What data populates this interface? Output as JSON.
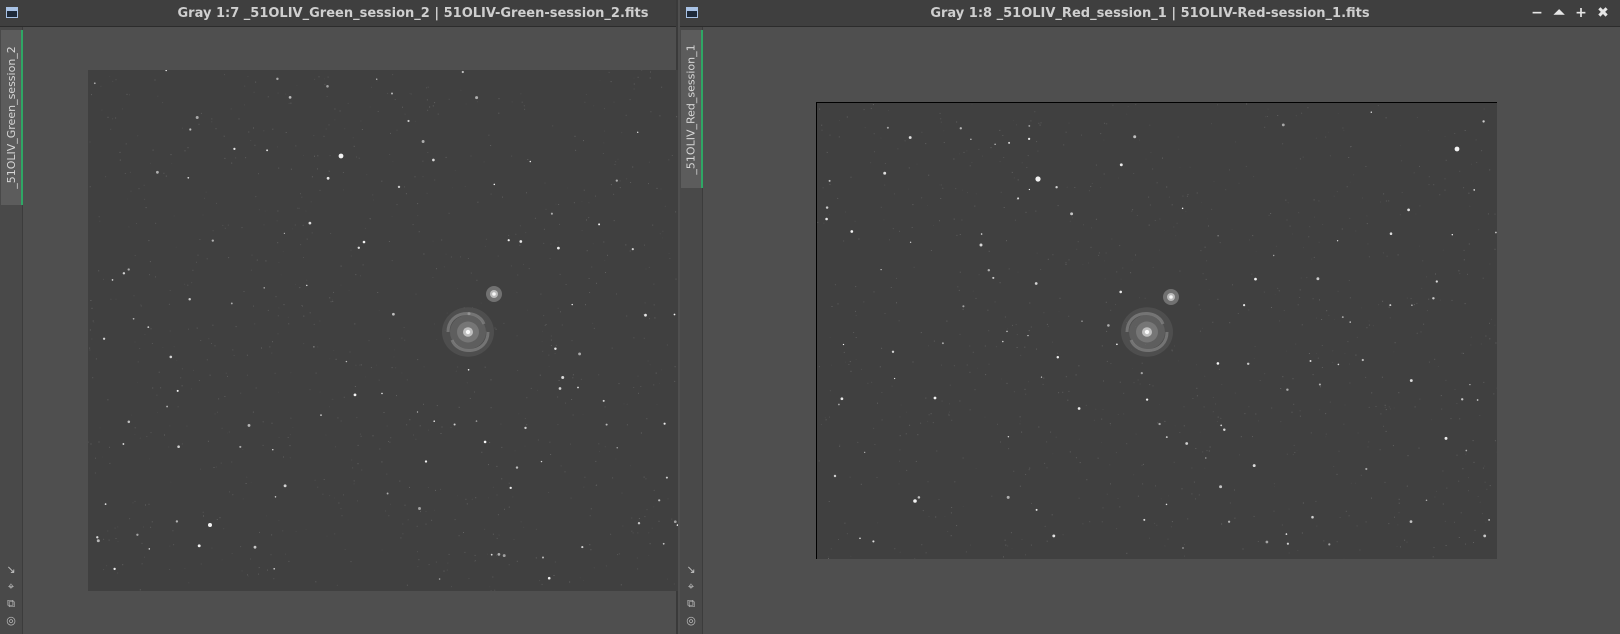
{
  "left_window": {
    "title": "Gray 1:7 _51OLIV_Green_session_2 | 51OLIV-Green-session_2.fits",
    "tab_label": "_51OLIV_Green_session_2",
    "icons": [
      "window-icon",
      "arrow-icon",
      "crosshair-icon",
      "copy-icon",
      "target-icon"
    ]
  },
  "right_window": {
    "title": "Gray 1:8 _51OLIV_Red_session_1 | 51OLIV-Red-session_1.fits",
    "tab_label": "_51OLIV_Red_session_1",
    "controls": {
      "minimize": "−",
      "shade": "⏶",
      "maximize": "+",
      "close": "✖"
    },
    "icons": [
      "window-icon",
      "arrow-icon",
      "crosshair-icon",
      "copy-icon",
      "target-icon"
    ]
  },
  "colors": {
    "background": "#4f4f4f",
    "titlebar": "#3f3f3f",
    "image_background": "#404040",
    "tab_accent": "#2fa765",
    "text": "#cfcfcf"
  }
}
